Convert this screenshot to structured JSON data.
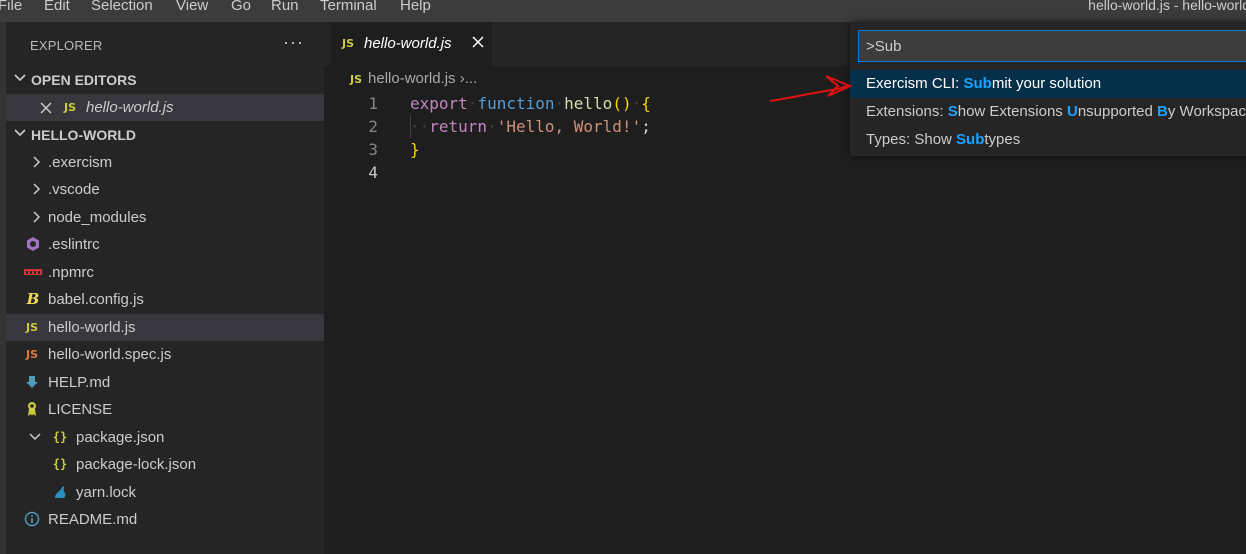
{
  "menubar": {
    "items": [
      "File",
      "Edit",
      "Selection",
      "View",
      "Go",
      "Run",
      "Terminal",
      "Help"
    ],
    "window_title": "hello-world.js - hello-world"
  },
  "sidebar": {
    "title": "EXPLORER",
    "more_glyph": "···",
    "open_editors": {
      "label": "OPEN EDITORS",
      "items": [
        {
          "label": "hello-world.js",
          "icon": "js-icon"
        }
      ]
    },
    "workspace": {
      "label": "HELLO-WORLD",
      "items": [
        {
          "label": ".exercism",
          "icon": "chevron-right-icon"
        },
        {
          "label": ".vscode",
          "icon": "chevron-right-icon"
        },
        {
          "label": "node_modules",
          "icon": "chevron-right-icon"
        },
        {
          "label": ".eslintrc",
          "icon": "eslint-icon"
        },
        {
          "label": ".npmrc",
          "icon": "npm-icon"
        },
        {
          "label": "babel.config.js",
          "icon": "babel-icon"
        },
        {
          "label": "hello-world.js",
          "icon": "js-icon"
        },
        {
          "label": "hello-world.spec.js",
          "icon": "js-icon"
        },
        {
          "label": "HELP.md",
          "icon": "markdown-icon"
        },
        {
          "label": "LICENSE",
          "icon": "license-icon"
        },
        {
          "label": "package.json",
          "icon": "json-icon"
        },
        {
          "label": "package-lock.json",
          "icon": "json-icon"
        },
        {
          "label": "yarn.lock",
          "icon": "yarn-icon"
        },
        {
          "label": "README.md",
          "icon": "info-icon"
        }
      ]
    }
  },
  "editor": {
    "tab": {
      "label": "hello-world.js",
      "icon_text": "JS"
    },
    "breadcrumb": {
      "file": "hello-world.js",
      "sep": "›",
      "rest": "..."
    },
    "lines": [
      {
        "num": "1"
      },
      {
        "num": "2"
      },
      {
        "num": "3"
      },
      {
        "num": "4"
      }
    ],
    "code": {
      "l1_export": "export",
      "l1_function": "function",
      "l1_name": "hello",
      "l1_parens": "()",
      "l1_brace": "{",
      "l2_return": "return",
      "l2_string": "'Hello, World!'",
      "l2_semi": ";",
      "l3_brace": "}"
    }
  },
  "palette": {
    "input_value": ">Sub",
    "items": [
      {
        "pre": "Exercism CLI: ",
        "hl": "Sub",
        "post": "mit your solution"
      },
      {
        "p1": "Extensions: ",
        "h1": "S",
        "p2": "how Extensions ",
        "h2": "U",
        "p3": "nsupported ",
        "h3": "B",
        "p4": "y Workspace"
      },
      {
        "pre": "Types: Show ",
        "hl": "Sub",
        "post": "types"
      }
    ]
  },
  "colors": {
    "accent": "#007fd4",
    "match_highlight": "#18a3ff",
    "annotation_arrow": "#e01010"
  }
}
